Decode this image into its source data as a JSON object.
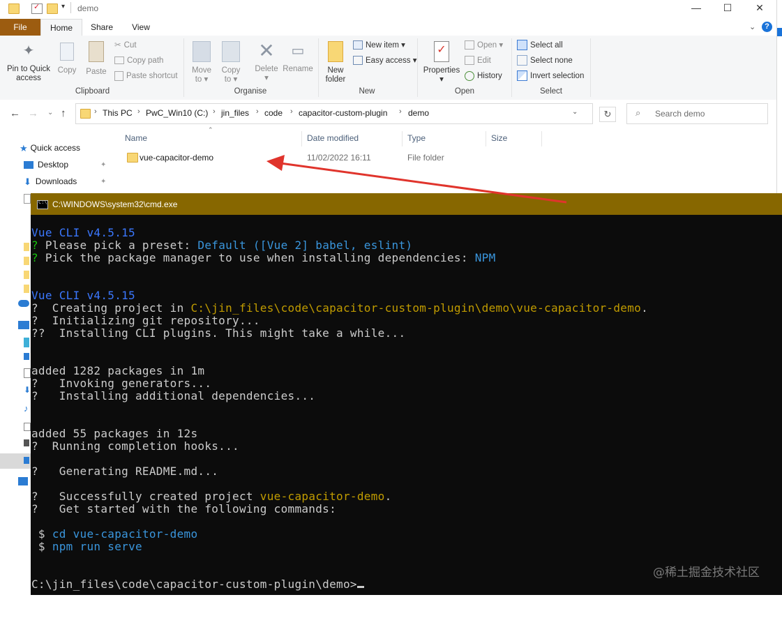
{
  "explorer": {
    "title": "demo",
    "window_controls": {
      "minimize": "—",
      "maximize": "☐",
      "close": "✕"
    },
    "tabs": {
      "file": "File",
      "home": "Home",
      "share": "Share",
      "view": "View"
    },
    "ribbon": {
      "clipboard": {
        "label": "Clipboard",
        "pin": [
          "Pin to Quick",
          "access"
        ],
        "copy": "Copy",
        "paste": "Paste",
        "cut": "Cut",
        "copy_path": "Copy path",
        "paste_shortcut": "Paste shortcut"
      },
      "organise": {
        "label": "Organise",
        "move_to": [
          "Move",
          "to ▾"
        ],
        "copy_to": [
          "Copy",
          "to ▾"
        ],
        "delete": [
          "Delete",
          "▾"
        ],
        "rename": "Rename"
      },
      "new": {
        "label": "New",
        "new_folder": [
          "New",
          "folder"
        ],
        "new_item": "New item ▾",
        "easy_access": "Easy access ▾"
      },
      "open": {
        "label": "Open",
        "properties": [
          "Properties",
          "▾"
        ],
        "open": "Open ▾",
        "edit": "Edit",
        "history": "History"
      },
      "select": {
        "label": "Select",
        "select_all": "Select all",
        "select_none": "Select none",
        "invert_selection": "Invert selection"
      }
    },
    "address": {
      "breadcrumbs": [
        "This PC",
        "PwC_Win10 (C:)",
        "jin_files",
        "code",
        "capacitor-custom-plugin",
        "demo"
      ],
      "search_placeholder": "Search demo"
    },
    "columns": {
      "name": "Name",
      "date": "Date modified",
      "type": "Type",
      "size": "Size"
    },
    "files": [
      {
        "name": "vue-capacitor-demo",
        "date": "11/02/2022 16:11",
        "type": "File folder",
        "size": ""
      }
    ],
    "nav": {
      "quick_access": "Quick access",
      "desktop": "Desktop",
      "downloads": "Downloads"
    }
  },
  "cmd": {
    "title": "C:\\WINDOWS\\system32\\cmd.exe",
    "lines": [
      [
        {
          "t": "Vue CLI v4.5.15",
          "c": "blue"
        }
      ],
      [
        {
          "t": "? ",
          "c": "green"
        },
        {
          "t": "Please pick a preset: ",
          "c": "white"
        },
        {
          "t": "Default ([Vue 2] babel, eslint)",
          "c": "cyan"
        }
      ],
      [
        {
          "t": "? ",
          "c": "green"
        },
        {
          "t": "Pick the package manager to use when installing dependencies: ",
          "c": "white"
        },
        {
          "t": "NPM",
          "c": "cyan"
        }
      ],
      [],
      [],
      [
        {
          "t": "Vue CLI v4.5.15",
          "c": "blue"
        }
      ],
      [
        {
          "t": "?  Creating project in ",
          "c": "white"
        },
        {
          "t": "C:\\jin_files\\code\\capacitor-custom-plugin\\demo\\vue-capacitor-demo",
          "c": "yellow"
        },
        {
          "t": ".",
          "c": "white"
        }
      ],
      [
        {
          "t": "?  Initializing git repository...",
          "c": "white"
        }
      ],
      [
        {
          "t": "??  Installing CLI plugins. This might take a while...",
          "c": "white"
        }
      ],
      [],
      [],
      [
        {
          "t": "added 1282 packages in 1m",
          "c": "white"
        }
      ],
      [
        {
          "t": "?   Invoking generators...",
          "c": "white"
        }
      ],
      [
        {
          "t": "?   Installing additional dependencies...",
          "c": "white"
        }
      ],
      [],
      [],
      [
        {
          "t": "added 55 packages in 12s",
          "c": "white"
        }
      ],
      [
        {
          "t": "?  Running completion hooks...",
          "c": "white"
        }
      ],
      [],
      [
        {
          "t": "?   Generating README.md...",
          "c": "white"
        }
      ],
      [],
      [
        {
          "t": "?   Successfully created project ",
          "c": "white"
        },
        {
          "t": "vue-capacitor-demo",
          "c": "yellow"
        },
        {
          "t": ".",
          "c": "white"
        }
      ],
      [
        {
          "t": "?   Get started with the following commands:",
          "c": "white"
        }
      ],
      [],
      [
        {
          "t": " $ ",
          "c": "white"
        },
        {
          "t": "cd vue-capacitor-demo",
          "c": "cyan"
        }
      ],
      [
        {
          "t": " $ ",
          "c": "white"
        },
        {
          "t": "npm run serve",
          "c": "cyan"
        }
      ],
      [],
      [],
      [
        {
          "t": "C:\\jin_files\\code\\capacitor-custom-plugin\\demo>",
          "c": "white"
        }
      ]
    ]
  },
  "watermark": "@稀土掘金技术社区",
  "colors": {
    "file_tab": "#9c5c10",
    "cmd_title": "#876700",
    "arrow": "#e0342c"
  }
}
